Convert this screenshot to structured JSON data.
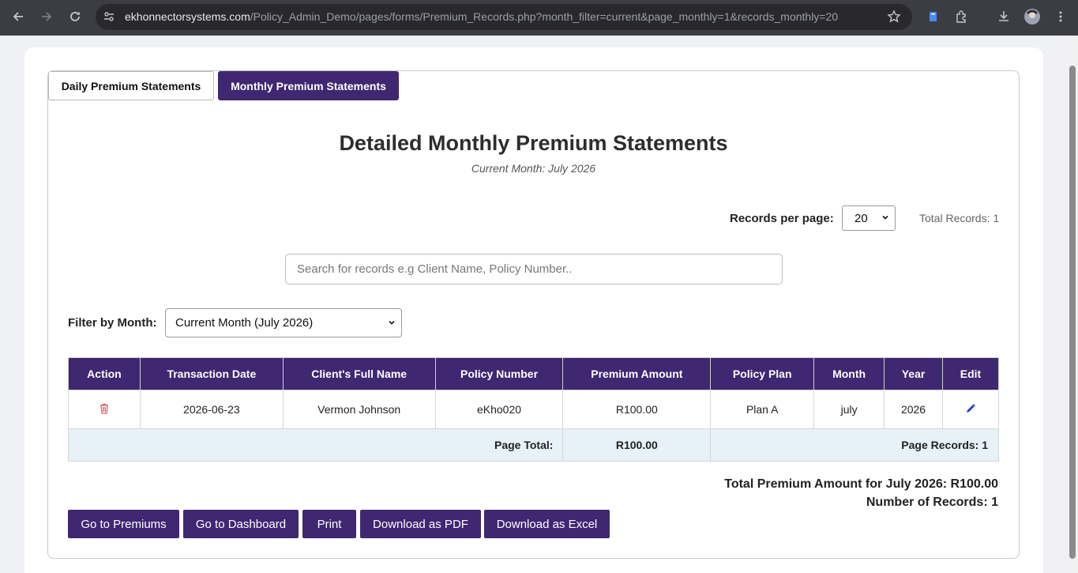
{
  "browser": {
    "url_host": "ekhonnectorsystems.com",
    "url_path": "/Policy_Admin_Demo/pages/forms/Premium_Records.php?month_filter=current&page_monthly=1&records_monthly=20"
  },
  "tabs": {
    "daily": "Daily Premium Statements",
    "monthly": "Monthly Premium Statements"
  },
  "header": {
    "title": "Detailed Monthly Premium Statements",
    "subtitle": "Current Month: July 2026"
  },
  "records_per_page": {
    "label": "Records per page:",
    "value": "20",
    "total": "Total Records: 1"
  },
  "search": {
    "placeholder": "Search for records e.g Client Name, Policy Number.."
  },
  "filter": {
    "label": "Filter by Month:",
    "value": "Current Month (July 2026)"
  },
  "table": {
    "columns": [
      "Action",
      "Transaction Date",
      "Client's Full Name",
      "Policy Number",
      "Premium Amount",
      "Policy Plan",
      "Month",
      "Year",
      "Edit"
    ],
    "rows": [
      {
        "date": "2026-06-23",
        "client": "Vermon Johnson",
        "policy_number": "eKho020",
        "premium": "R100.00",
        "plan": "Plan A",
        "month": "july",
        "year": "2026"
      }
    ],
    "page_total_label": "Page Total:",
    "page_total_value": "R100.00",
    "page_records": "Page Records: 1"
  },
  "summary": {
    "total_premium": "Total Premium Amount for July 2026: R100.00",
    "num_records": "Number of Records: 1"
  },
  "buttons": {
    "premiums": "Go to Premiums",
    "dashboard": "Go to Dashboard",
    "print": "Print",
    "pdf": "Download as PDF",
    "excel": "Download as Excel"
  },
  "colors": {
    "accent": "#3f2771",
    "total_row_bg": "#e6f2f7",
    "delete_icon": "#e05a5a",
    "edit_icon": "#1a3fd6"
  },
  "icons": {
    "delete": "trash-icon",
    "edit": "pencil-icon"
  }
}
